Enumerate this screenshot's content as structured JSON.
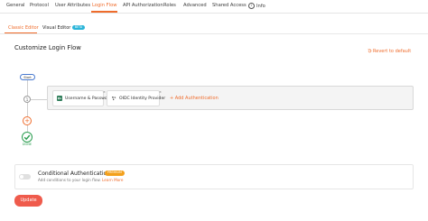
{
  "top_tabs": [
    {
      "label": "General"
    },
    {
      "label": "Protocol"
    },
    {
      "label": "User Attributes"
    },
    {
      "label": "Login Flow",
      "active": true
    },
    {
      "label": "API Authorization"
    },
    {
      "label": "Roles"
    },
    {
      "label": "Advanced"
    },
    {
      "label": "Shared Access"
    },
    {
      "label": "Info"
    }
  ],
  "sub_tabs": {
    "classic": "Classic Editor",
    "visual": "Visual Editor",
    "visual_badge": "BETA"
  },
  "page_title": "Customize Login Flow",
  "revert_label": "Revert to default",
  "flow": {
    "start_label": "Start",
    "step_number": "1",
    "authenticators": [
      {
        "label": "Username & Password",
        "icon": "key-icon",
        "icon_color": "#2f7d5a"
      },
      {
        "label": "OIDC Identity Provider",
        "icon": "federation-icon",
        "icon_color": "#555555"
      }
    ],
    "add_authentication": "+ Add Authentication",
    "done_label": "DONE"
  },
  "conditional": {
    "title": "Conditional Authentication",
    "badge": "PREMIUM",
    "description": "Add conditions to your login flow.",
    "learn_more": "Learn More",
    "enabled": false
  },
  "update_label": "Update",
  "colors": {
    "accent": "#ef6c2c",
    "success": "#2a9d4f",
    "update_button": "#ef5b4c",
    "beta_badge": "#2bb5d9",
    "premium_badge": "#f3a01c"
  }
}
